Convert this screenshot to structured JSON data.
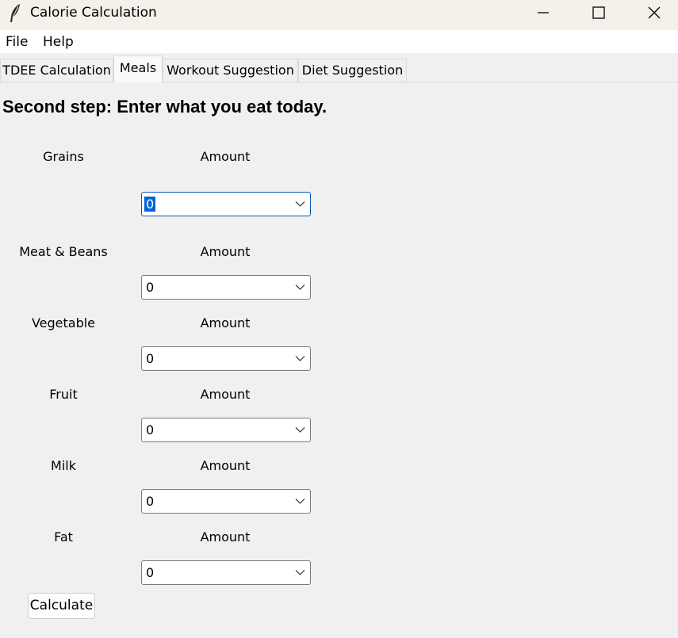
{
  "window": {
    "title": "Calorie Calculation",
    "icon": "feather-icon",
    "controls": [
      "minimize-icon",
      "maximize-icon",
      "close-icon"
    ]
  },
  "menu": [
    "File",
    "Help"
  ],
  "tabs": [
    {
      "label": "TDEE Calculation",
      "active": false
    },
    {
      "label": "Meals",
      "active": true
    },
    {
      "label": "Workout Suggestion",
      "active": false
    },
    {
      "label": "Diet Suggestion",
      "active": false
    }
  ],
  "heading": "Second step: Enter what you eat today.",
  "foods": [
    {
      "name": "Grains",
      "amount_label": "Amount",
      "value": "0",
      "focused": true
    },
    {
      "name": "Meat & Beans",
      "amount_label": "Amount",
      "value": "0",
      "focused": false
    },
    {
      "name": "Vegetable",
      "amount_label": "Amount",
      "value": "0",
      "focused": false
    },
    {
      "name": "Fruit",
      "amount_label": "Amount",
      "value": "0",
      "focused": false
    },
    {
      "name": "Milk",
      "amount_label": "Amount",
      "value": "0",
      "focused": false
    },
    {
      "name": "Fat",
      "amount_label": "Amount",
      "value": "0",
      "focused": false
    }
  ],
  "calculate_label": "Calculate",
  "colors": {
    "selection": "#0064d6",
    "focus_border": "#0b5ab8"
  }
}
